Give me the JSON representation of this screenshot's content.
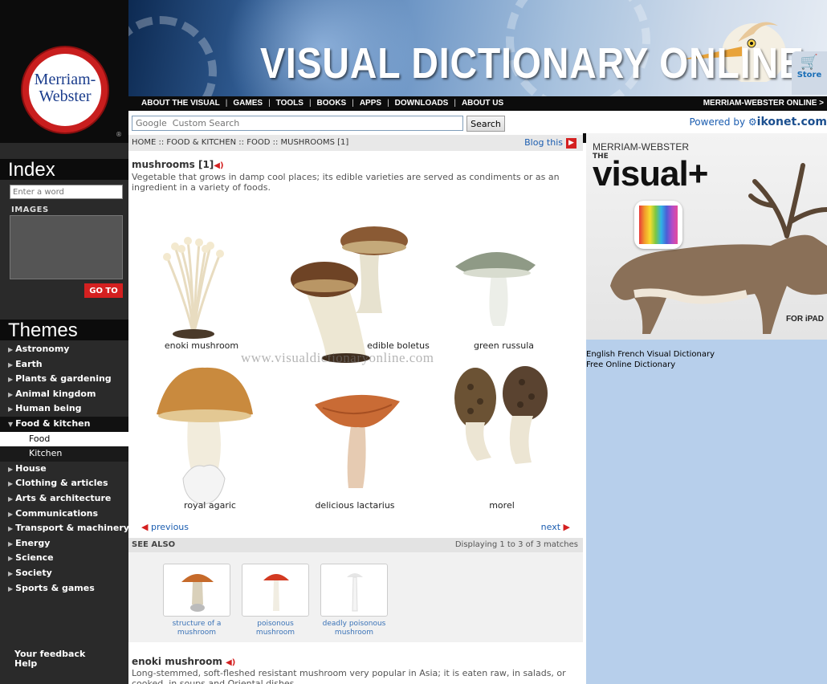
{
  "header": {
    "banner_title": "VISUAL DICTIONARY ONLINE",
    "logo_line1": "Merriam-",
    "logo_line2": "Webster",
    "store_label": "Store",
    "nav": [
      "ABOUT THE VISUAL",
      "GAMES",
      "TOOLS",
      "BOOKS",
      "APPS",
      "DOWNLOADS",
      "ABOUT US"
    ],
    "mw_online": "MERRIAM-WEBSTER ONLINE >"
  },
  "search": {
    "placeholder": "Google  Custom Search",
    "button": "Search",
    "powered_by": "Powered by",
    "powered_brand": "ikonet.com"
  },
  "sidebar": {
    "index_title": "Index",
    "index_placeholder": "Enter a word",
    "images_label": "IMAGES",
    "goto_button": "GO TO",
    "themes_title": "Themes",
    "themes": [
      {
        "label": "Astronomy"
      },
      {
        "label": "Earth"
      },
      {
        "label": "Plants & gardening"
      },
      {
        "label": "Animal kingdom"
      },
      {
        "label": "Human being"
      },
      {
        "label": "Food & kitchen",
        "expanded": true
      },
      {
        "label": "Food",
        "sub": true,
        "current": true
      },
      {
        "label": "Kitchen",
        "sub": true
      },
      {
        "label": "House"
      },
      {
        "label": "Clothing & articles"
      },
      {
        "label": "Arts & architecture"
      },
      {
        "label": "Communications"
      },
      {
        "label": "Transport & machinery"
      },
      {
        "label": "Energy"
      },
      {
        "label": "Science"
      },
      {
        "label": "Society"
      },
      {
        "label": "Sports & games"
      }
    ],
    "feedback": "Your feedback",
    "help": "Help"
  },
  "main": {
    "breadcrumb": "HOME :: FOOD & KITCHEN :: FOOD :: MUSHROOMS [1]",
    "blog_label": "Blog this",
    "term_title": "mushrooms [1]",
    "term_definition": "Vegetable that grows in damp cool places; its edible varieties are served as condiments or as an ingredient in a variety of foods.",
    "watermark": "www.visualdictionaryonline.com",
    "labels": {
      "enoki": "enoki mushroom",
      "boletus": "edible boletus",
      "russula": "green russula",
      "agaric": "royal agaric",
      "lactarius": "delicious lactarius",
      "morel": "morel"
    },
    "prev_label": "previous",
    "next_label": "next",
    "see_also_title": "SEE ALSO",
    "see_also_count": "Displaying 1 to 3 of 3 matches",
    "see_also": [
      {
        "line1": "structure of a",
        "line2": "mushroom"
      },
      {
        "line1": "poisonous",
        "line2": "mushroom"
      },
      {
        "line1": "deadly poisonous",
        "line2": "mushroom"
      }
    ],
    "entry_title": "enoki mushroom",
    "entry_definition": "Long-stemmed, soft-fleshed resistant mushroom very popular in Asia; it is eaten raw, in salads, or cooked, in soups and Oriental dishes."
  },
  "ad": {
    "brand": "MERRIAM-WEBSTER",
    "the": "THE",
    "product": "visual+",
    "platform": "FOR iPAD",
    "links": [
      "English French Visual Dictionary",
      "Free Online Dictionary"
    ]
  },
  "colors": {
    "accent_red": "#d42020",
    "link_blue": "#1b5db0",
    "sidebar_dark": "#2a2a2a",
    "right_panel": "#b7cfeb"
  }
}
